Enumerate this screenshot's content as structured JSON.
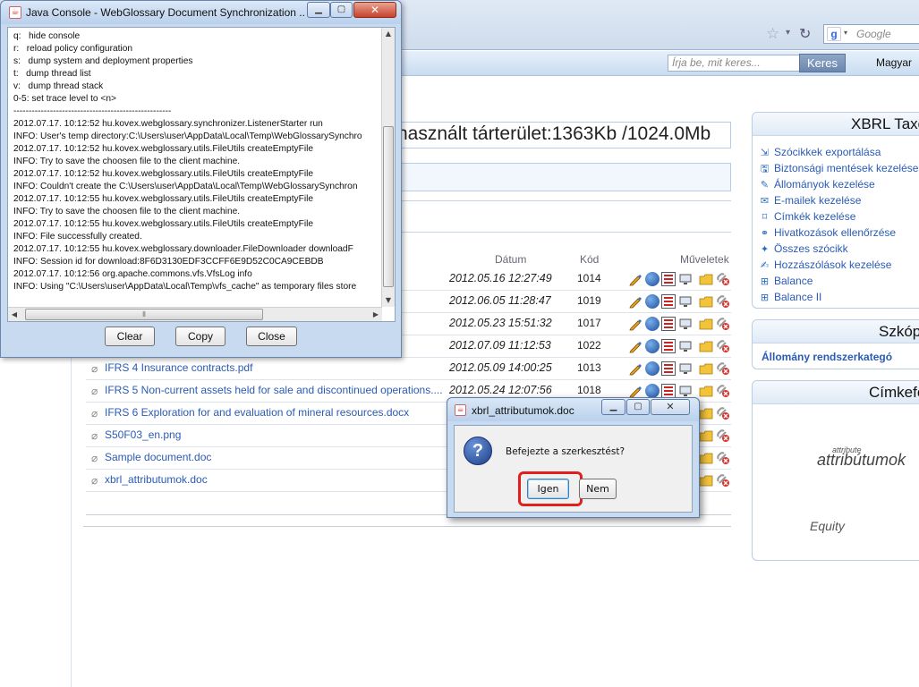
{
  "browser": {
    "search_engine_placeholder": "Google",
    "star_glyph": "☆",
    "reload_glyph": "↻"
  },
  "site_header": {
    "search_placeholder": "Írja be, mit keres...",
    "search_button": "Keres",
    "language_link": "Magyar"
  },
  "main": {
    "storage_text": "használt tárterület:1363Kb /1024.0Mb",
    "columns": {
      "date": "Dátum",
      "code": "Kód",
      "operations": "Műveletek"
    },
    "rows": [
      {
        "name": "",
        "date": "2012.05.16 12:27:49",
        "code": "1014"
      },
      {
        "name": "",
        "date": "2012.06.05 11:28:47",
        "code": "1019"
      },
      {
        "name": "",
        "date": "2012.05.23 15:51:32",
        "code": "1017"
      },
      {
        "name": "g Stand...",
        "date": "2012.07.09 11:12:53",
        "code": "1022"
      },
      {
        "name": "IFRS 4 Insurance contracts.pdf",
        "date": "2012.05.09 14:00:25",
        "code": "1013"
      },
      {
        "name": "IFRS 5 Non-current assets held for sale and discontinued operations....",
        "date": "2012.05.24 12:07:56",
        "code": "1018"
      },
      {
        "name": "IFRS 6 Exploration for and evaluation of mineral resources.docx",
        "date": "",
        "code": ""
      },
      {
        "name": "S50F03_en.png",
        "date": "",
        "code": ""
      },
      {
        "name": "Sample document.doc",
        "date": "",
        "code": ""
      },
      {
        "name": "xbrl_attributumok.doc",
        "date": "",
        "code": ""
      }
    ]
  },
  "side_panels": {
    "panel1": {
      "title": "XBRL Taxo",
      "items": [
        {
          "label": "Szócikkek exportálása",
          "icon": "export-icon"
        },
        {
          "label": "Biztonsági mentések kezelése",
          "icon": "backup-icon"
        },
        {
          "label": "Állományok kezelése",
          "icon": "files-icon"
        },
        {
          "label": "E-mailek kezelése",
          "icon": "email-icon"
        },
        {
          "label": "Címkék kezelése",
          "icon": "tag-icon"
        },
        {
          "label": "Hivatkozások ellenőrzése",
          "icon": "link-check-icon"
        },
        {
          "label": "Összes szócikk",
          "icon": "all-entries-icon"
        },
        {
          "label": "Hozzászólások kezelése",
          "icon": "comments-icon"
        },
        {
          "label": "Balance",
          "icon": "tree-icon"
        },
        {
          "label": "Balance II",
          "icon": "tree-icon"
        }
      ]
    },
    "panel2": {
      "title": "Szkóp",
      "link": "Állomány rendszerkategó"
    },
    "panel3": {
      "title": "Címkefe",
      "tag_small": "attribute",
      "tag_big": "attribútumok",
      "tag_equity": "Equity"
    }
  },
  "java_console": {
    "title": "Java Console - WebGlossary Document Synchronization ...",
    "lines": [
      "q:   hide console",
      "r:   reload policy configuration",
      "s:   dump system and deployment properties",
      "t:   dump thread list",
      "v:   dump thread stack",
      "0-5: set trace level to <n>",
      "----------------------------------------------------",
      "2012.07.17. 10:12:52 hu.kovex.webglossary.synchronizer.ListenerStarter run",
      "INFO: User's temp directory:C:\\Users\\user\\AppData\\Local\\Temp\\WebGlossarySynchro",
      "2012.07.17. 10:12:52 hu.kovex.webglossary.utils.FileUtils createEmptyFile",
      "INFO: Try to save the choosen file to the client machine.",
      "2012.07.17. 10:12:52 hu.kovex.webglossary.utils.FileUtils createEmptyFile",
      "INFO: Couldn't create the C:\\Users\\user\\AppData\\Local\\Temp\\WebGlossarySynchron",
      "2012.07.17. 10:12:55 hu.kovex.webglossary.utils.FileUtils createEmptyFile",
      "INFO: Try to save the choosen file to the client machine.",
      "2012.07.17. 10:12:55 hu.kovex.webglossary.utils.FileUtils createEmptyFile",
      "INFO: File successfully created.",
      "2012.07.17. 10:12:55 hu.kovex.webglossary.downloader.FileDownloader downloadF",
      "INFO: Session id for download:8F6D3130EDF3CCFF6E9D52C0CA9CEBDB",
      "2012.07.17. 10:12:56 org.apache.commons.vfs.VfsLog info",
      "INFO: Using \"C:\\Users\\user\\AppData\\Local\\Temp\\vfs_cache\" as temporary files store"
    ],
    "buttons": {
      "clear": "Clear",
      "copy": "Copy",
      "close": "Close"
    }
  },
  "confirm_dialog": {
    "title": "xbrl_attributumok.doc",
    "message": "Befejezte a szerkesztést?",
    "yes": "Igen",
    "no": "Nem",
    "highlight_color": "#e0201a"
  }
}
